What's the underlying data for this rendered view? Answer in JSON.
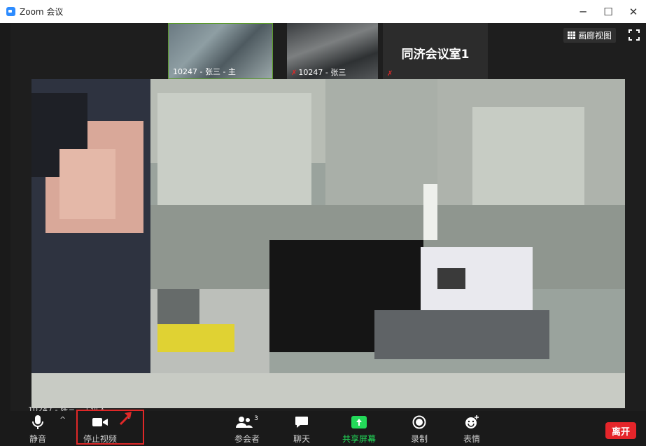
{
  "window": {
    "title": "Zoom 会议",
    "controls": {
      "minimize": "─",
      "maximize": "☐",
      "close": "✕"
    }
  },
  "thumbnails": [
    {
      "label": "10247 - 张三 - 主"
    },
    {
      "label": "10247 - 张三"
    },
    {
      "label": "同济会议室1"
    }
  ],
  "view": {
    "gallery_label": "画廊视图"
  },
  "main_video": {
    "speaker_label": "10247 - 张三 - 主讲人"
  },
  "toolbar": {
    "mute_label": "静音",
    "stop_video_label": "停止视频",
    "participants_label": "参会者",
    "participants_count": "3",
    "chat_label": "聊天",
    "share_label": "共享屏幕",
    "record_label": "录制",
    "reactions_label": "表情",
    "leave_label": "离开"
  },
  "colors": {
    "accent": "#2d8cff",
    "share_green": "#23d959",
    "leave_red": "#e5252a",
    "highlight": "#e02828"
  }
}
